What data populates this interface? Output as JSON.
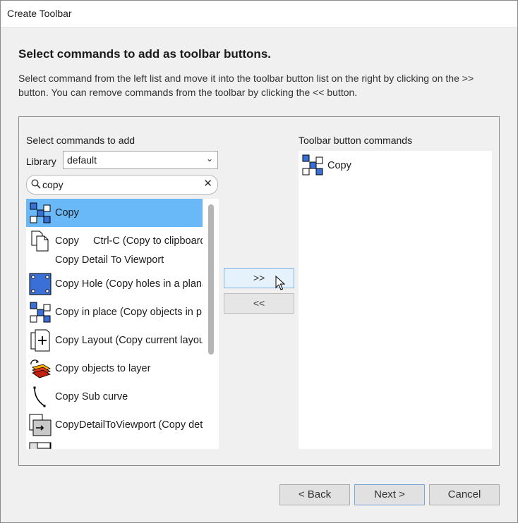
{
  "window": {
    "title": "Create Toolbar"
  },
  "page": {
    "heading": "Select commands to add as toolbar buttons.",
    "description": "Select command from the left list and move it into the toolbar button list on the right by clicking on the >> button. You can remove commands from the toolbar by clicking the << button."
  },
  "left_panel": {
    "label": "Select commands to add",
    "library_label": "Library",
    "library_value": "default",
    "search_value": "copy",
    "items": [
      {
        "label": "Copy",
        "shortcut": "",
        "icon": "copy-objects-icon",
        "selected": true
      },
      {
        "label": "Copy",
        "shortcut": "Ctrl-C (Copy to clipboard)",
        "icon": "copy-clipboard-icon",
        "selected": false
      },
      {
        "label": "Copy Detail To Viewport",
        "shortcut": "",
        "icon": "",
        "selected": false
      },
      {
        "label": "Copy Hole (Copy holes in a planar surface)",
        "shortcut": "",
        "icon": "copy-hole-icon",
        "selected": false
      },
      {
        "label": "Copy in place (Copy objects in place)",
        "shortcut": "",
        "icon": "copy-in-place-icon",
        "selected": false
      },
      {
        "label": "Copy Layout (Copy current layout)",
        "shortcut": "",
        "icon": "copy-layout-icon",
        "selected": false
      },
      {
        "label": "Copy objects to layer",
        "shortcut": "",
        "icon": "copy-to-layer-icon",
        "selected": false
      },
      {
        "label": "Copy Sub curve",
        "shortcut": "",
        "icon": "sub-curve-icon",
        "selected": false
      },
      {
        "label": "CopyDetailToViewport (Copy detail to viewport)",
        "shortcut": "",
        "icon": "detail-to-viewport-icon",
        "selected": false
      }
    ]
  },
  "move_buttons": {
    "add": ">>",
    "remove": "<<"
  },
  "right_panel": {
    "label": "Toolbar button commands",
    "items": [
      {
        "label": "Copy",
        "icon": "copy-objects-icon"
      }
    ]
  },
  "footer": {
    "back": "< Back",
    "next": "Next >",
    "cancel": "Cancel"
  },
  "colors": {
    "selection": "#69b9f9",
    "icon_blue": "#3a6fd6",
    "window_bg": "#f0f0f0"
  }
}
